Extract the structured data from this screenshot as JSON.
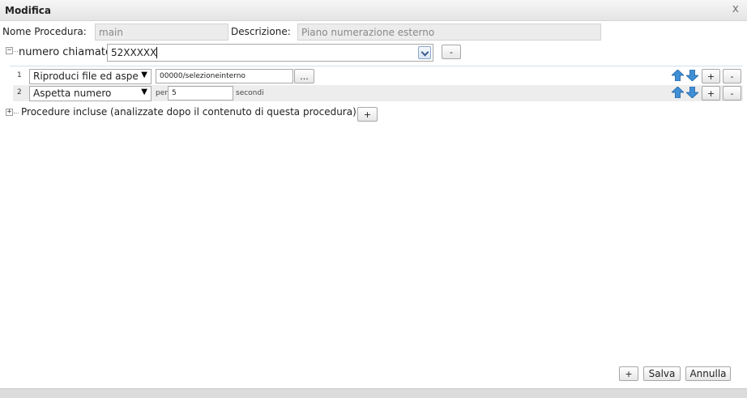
{
  "dialog": {
    "title": "Modifica",
    "close_glyph": "x"
  },
  "header": {
    "nome_label": "Nome Procedura:",
    "nome_value": "main",
    "desc_label": "Descrizione:",
    "desc_value": "Piano numerazione esterno"
  },
  "match": {
    "label": "numero chiamato",
    "value": "52XXXXX",
    "minus_label": "-"
  },
  "steps": [
    {
      "num": "1",
      "action": "Riproduci file ed aspe",
      "file": "00000/selezioneinterno",
      "browse_label": "..."
    },
    {
      "num": "2",
      "action": "Aspetta numero",
      "per_label": "per",
      "seconds_value": "5",
      "seconds_label": "secondi"
    }
  ],
  "row_buttons": {
    "add": "+",
    "remove": "-"
  },
  "included": {
    "label": "Procedure incluse (analizzate dopo il contenuto di questa procedura)",
    "add_label": "+"
  },
  "footer": {
    "add": "+",
    "save": "Salva",
    "cancel": "Annulla"
  },
  "icons": {
    "toggle_expanded": "minus-box-icon",
    "toggle_collapsed": "plus-box-icon",
    "move_up": "arrow-up-icon",
    "move_down": "arrow-down-icon"
  },
  "colors": {
    "arrow_blue": "#3f8fd6",
    "field_bg": "#ececec"
  }
}
